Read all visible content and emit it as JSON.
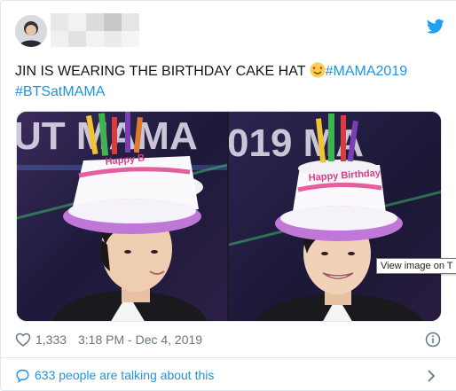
{
  "tweet": {
    "text_main": "JIN IS WEARING THE BIRTHDAY CAKE HAT ",
    "emoji": "smiling-face-with-heart-eyes-emoji",
    "hashtags": [
      "#MAMA2019",
      "#BTSatMAMA"
    ]
  },
  "media": {
    "left_photo_sign": "UT MAMA",
    "right_photo_sign": "019 MA",
    "hat_text": "Happy Birthday",
    "tooltip": "View image on T"
  },
  "meta": {
    "likes": "1,333",
    "timestamp": "3:18 PM - Dec 4, 2019"
  },
  "footer": {
    "talking": "633 people are talking about this"
  },
  "colors": {
    "link": "#1b95e0",
    "muted": "#657786",
    "border": "#e1e8ed",
    "twitter_blue": "#1da1f2"
  },
  "icons": [
    "twitter-bird-icon",
    "heart-icon",
    "info-icon",
    "comment-bubble-icon",
    "chevron-right-icon"
  ]
}
